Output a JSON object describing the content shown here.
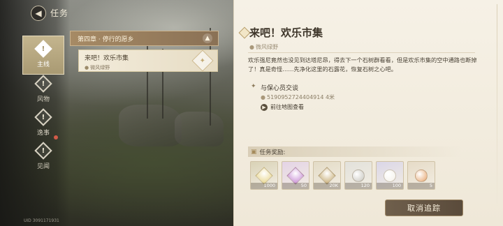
{
  "header": {
    "title": "任务",
    "back_icon": "back-arrow-icon"
  },
  "sidebar": {
    "items": [
      {
        "label": "主线",
        "icon": "quest-diamond-icon",
        "active": true
      },
      {
        "label": "风物",
        "icon": "quest-diamond-icon",
        "active": false
      },
      {
        "label": "逸事",
        "icon": "quest-diamond-icon",
        "active": false,
        "notification": true
      },
      {
        "label": "见闻",
        "icon": "quest-diamond-icon",
        "active": false
      }
    ]
  },
  "quest_list": {
    "chapter": "第四章 · 停行的愿乡",
    "quests": [
      {
        "title": "来吧！欢乐市集",
        "location": "微风绿野"
      }
    ]
  },
  "detail": {
    "title": "来吧！欢乐市集",
    "location": "微风绿野",
    "description": "欢乐强尼竟然也没见到达塔尼昂，得去下一个石树群看看，但是欢乐市集的空中通路也断掉了！真是奇怪……先净化这里的石露花，恢复石树之心吧。",
    "objective": {
      "title": "与保心员交谈",
      "distance": "5190952724404914 4米",
      "link": "前往地图查看"
    },
    "rewards_label": "任务奖励:",
    "rewards": [
      {
        "count": "1000",
        "icon": "star-crystal-icon",
        "bg": "#d9d2b6",
        "color": "#e9d78f"
      },
      {
        "count": "50",
        "icon": "pink-gem-icon",
        "bg": "#e4d3e6",
        "color": "#c98fd6"
      },
      {
        "count": "20K",
        "icon": "gold-star-icon",
        "bg": "#e3dbc6",
        "color": "#c9b07a"
      },
      {
        "count": "120",
        "icon": "silver-bow-icon",
        "bg": "#e2e1db",
        "color": "#c6c4bc"
      },
      {
        "count": "100",
        "icon": "pearl-orb-icon",
        "bg": "#dad6e8",
        "color": "#f4f0e8"
      },
      {
        "count": "5",
        "icon": "peach-fruit-icon",
        "bg": "#e6dbc7",
        "color": "#e6a46c"
      }
    ],
    "cancel_button": "取消追踪"
  },
  "footer": {
    "version": "UID 3091171931"
  }
}
